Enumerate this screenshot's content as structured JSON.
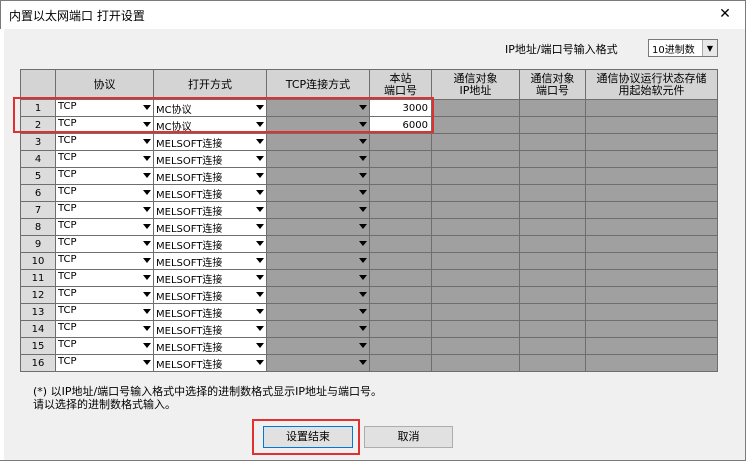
{
  "window": {
    "title": "内置以太网端口 打开设置"
  },
  "format": {
    "label": "IP地址/端口号输入格式",
    "value": "10进制数"
  },
  "headers": {
    "c1": "协议",
    "c2": "打开方式",
    "c3": "TCP连接方式",
    "c4a": "本站",
    "c4b": "端口号",
    "c5a": "通信对象",
    "c5b": "IP地址",
    "c6a": "通信对象",
    "c6b": "端口号",
    "c7a": "通信协议运行状态存储",
    "c7b": "用起始软元件"
  },
  "rows": [
    {
      "n": "1",
      "protocol": "TCP",
      "mode": "MC协议",
      "port": "3000"
    },
    {
      "n": "2",
      "protocol": "TCP",
      "mode": "MC协议",
      "port": "6000"
    },
    {
      "n": "3",
      "protocol": "TCP",
      "mode": "MELSOFT连接"
    },
    {
      "n": "4",
      "protocol": "TCP",
      "mode": "MELSOFT连接"
    },
    {
      "n": "5",
      "protocol": "TCP",
      "mode": "MELSOFT连接"
    },
    {
      "n": "6",
      "protocol": "TCP",
      "mode": "MELSOFT连接"
    },
    {
      "n": "7",
      "protocol": "TCP",
      "mode": "MELSOFT连接"
    },
    {
      "n": "8",
      "protocol": "TCP",
      "mode": "MELSOFT连接"
    },
    {
      "n": "9",
      "protocol": "TCP",
      "mode": "MELSOFT连接"
    },
    {
      "n": "10",
      "protocol": "TCP",
      "mode": "MELSOFT连接"
    },
    {
      "n": "11",
      "protocol": "TCP",
      "mode": "MELSOFT连接"
    },
    {
      "n": "12",
      "protocol": "TCP",
      "mode": "MELSOFT连接"
    },
    {
      "n": "13",
      "protocol": "TCP",
      "mode": "MELSOFT连接"
    },
    {
      "n": "14",
      "protocol": "TCP",
      "mode": "MELSOFT连接"
    },
    {
      "n": "15",
      "protocol": "TCP",
      "mode": "MELSOFT连接"
    },
    {
      "n": "16",
      "protocol": "TCP",
      "mode": "MELSOFT连接"
    }
  ],
  "note": {
    "line1": "(*) 以IP地址/端口号输入格式中选择的进制数格式显示IP地址与端口号。",
    "line2": "请以选择的进制数格式输入。"
  },
  "buttons": {
    "ok": "设置结束",
    "cancel": "取消"
  },
  "icons": {
    "close": "close-icon",
    "dropdown": "chevron-down-icon"
  },
  "colors": {
    "highlight": "#e0302f",
    "disabled_cell": "#a0a0a0"
  }
}
